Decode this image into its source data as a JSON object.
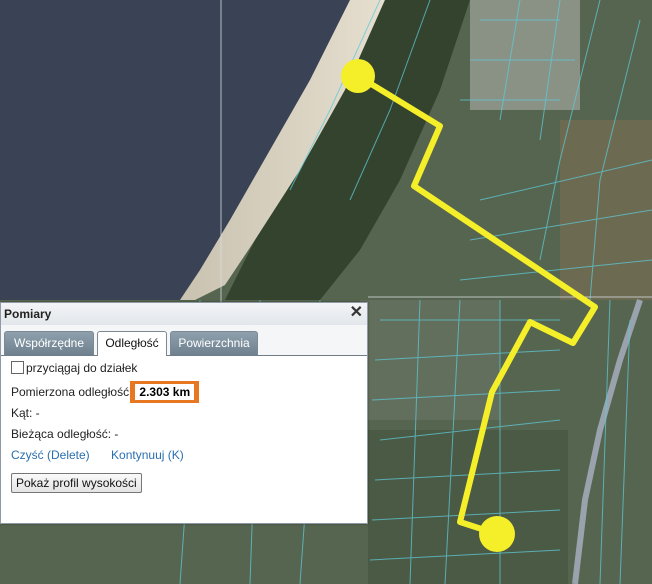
{
  "map": {
    "route_color": "#f5ef2a",
    "sea_color": "#3a4256",
    "background_color": "#4f5f52"
  },
  "panel": {
    "title": "Pomiary",
    "close_glyph": "✕",
    "tabs": [
      {
        "label": "Współrzędne",
        "active": false
      },
      {
        "label": "Odległość",
        "active": true
      },
      {
        "label": "Powierzchnia",
        "active": false
      }
    ],
    "snap_checkbox_label": "przyciągaj do działek",
    "snap_checked": false,
    "measured_label": "Pomierzona odległość:",
    "measured_value": "2.303 km",
    "angle_text": "Kąt: -",
    "current_text": "Bieżąca odległość: -",
    "clear_link": "Czyść (Delete)",
    "continue_link": "Kontynuuj (K)",
    "profile_button": "Pokaż profil wysokości",
    "highlight_color": "#e87722"
  }
}
